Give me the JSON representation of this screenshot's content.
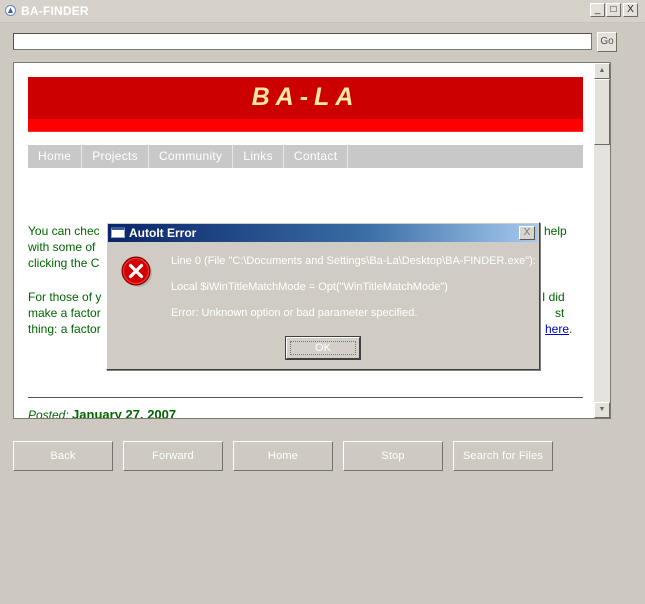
{
  "window": {
    "title": "BA-FINDER",
    "controls": [
      "_",
      "□",
      "X"
    ]
  },
  "address_bar": {
    "value": "",
    "placeholder": "",
    "go_label": "Go"
  },
  "page": {
    "site_title": "BA-LA",
    "nav": [
      "Home",
      "Projects",
      "Community",
      "Links",
      "Contact"
    ],
    "paragraph1": {
      "line1_left": "You can chec",
      "line1_right": "help",
      "line2_left": "with some of",
      "line3_left": "clicking the C"
    },
    "paragraph2": {
      "line1_left": "For those of y",
      "line1_right": "I did",
      "line2_left": "make a factor",
      "line2_right": "st",
      "line3_left": "thing: a factor",
      "link": "here",
      "link_suffix": "."
    },
    "posted_label": "Posted:",
    "posted_date": "January 27, 2007"
  },
  "toolbar": {
    "back": "Back",
    "forward": "Forward",
    "home": "Home",
    "stop": "Stop",
    "search": "Search for Files"
  },
  "dialog": {
    "title": "AutoIt Error",
    "close": "X",
    "line1": "Line 0  (File \"C:\\Documents and Settings\\Ba-La\\Desktop\\BA-FINDER.exe\"):",
    "line2": "Local $iWinTitleMatchMode = Opt(\"WinTitleMatchMode\")",
    "line3": "Error: Unknown option or bad parameter specified.",
    "ok": "OK"
  },
  "colors": {
    "banner_red": "#cc0000",
    "banner_stripe": "#ff0000",
    "site_title": "#ffe9a6",
    "body_text_green": "#006600",
    "link_blue": "#0000cc",
    "dialog_title_start": "#0a246a",
    "dialog_title_end": "#a6caf0",
    "error_icon_red": "#d40000"
  },
  "icons": {
    "app": "autoit-app-icon",
    "dialog": "window-icon",
    "error": "error-x-circle-icon",
    "scroll_up": "triangle-up-icon",
    "scroll_down": "triangle-down-icon"
  }
}
